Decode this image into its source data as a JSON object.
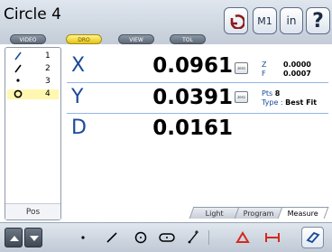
{
  "header": {
    "title": "Circle 4",
    "tabs": [
      {
        "label": "VIDEO",
        "active": false
      },
      {
        "label": "DRO",
        "active": true
      },
      {
        "label": "VIEW",
        "active": false
      },
      {
        "label": "TOL",
        "active": false
      }
    ],
    "buttons": {
      "undo_icon": "undo-arrow-icon",
      "m1": "M1",
      "units": "in",
      "help": "?"
    }
  },
  "feature_list": {
    "items": [
      {
        "number": "1",
        "icon": "line-icon",
        "selected": false
      },
      {
        "number": "2",
        "icon": "line-icon",
        "selected": false
      },
      {
        "number": "3",
        "icon": "point-icon",
        "selected": false
      },
      {
        "number": "4",
        "icon": "circle-icon",
        "selected": true
      }
    ],
    "footer": "Pos"
  },
  "readout": {
    "x": {
      "label": "X",
      "value": "0.0961",
      "zero": "zero"
    },
    "y": {
      "label": "Y",
      "value": "0.0391",
      "zero": "zero"
    },
    "d": {
      "label": "D",
      "value": "0.0161"
    },
    "z": {
      "label": "Z",
      "value": "0.0000"
    },
    "f": {
      "label": "F",
      "value": "0.0007"
    },
    "pts": {
      "label": "Pts",
      "value": "8"
    },
    "type": {
      "label": "Type :",
      "value": "Best Fit"
    }
  },
  "view_tabs": [
    {
      "label": "Light",
      "active": false
    },
    {
      "label": "Program",
      "active": false
    },
    {
      "label": "Measure",
      "active": true
    }
  ],
  "toolbar": {
    "tools": [
      "point-icon",
      "line-icon",
      "circle-icon",
      "slot-icon",
      "blob-icon",
      "angle-icon",
      "distance-icon",
      "skew-icon"
    ],
    "active_tool": "skew-icon",
    "colors": {
      "accent": "#1b4a9b",
      "highlight": "#fff7b0",
      "tool_red": "#d42a1c"
    }
  }
}
